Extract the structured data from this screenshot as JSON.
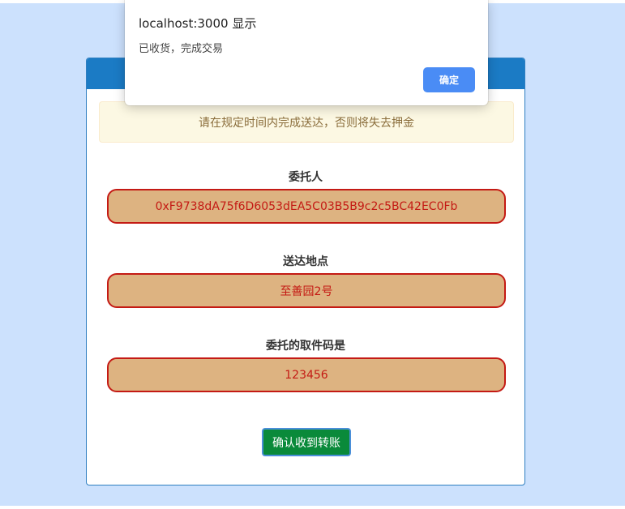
{
  "alert": {
    "title": "localhost:3000 显示",
    "message": "已收货，完成交易",
    "ok_label": "确定"
  },
  "card": {
    "warning": "请在规定时间内完成送达，否则将失去押金",
    "fields": [
      {
        "label": "委托人",
        "value": "0xF9738dA75f6D6053dEA5C03B5B9c2c5BC42EC0Fb"
      },
      {
        "label": "送达地点",
        "value": "至善园2号"
      },
      {
        "label": "委托的取件码是",
        "value": "123456"
      }
    ],
    "confirm_label": "确认收到转账"
  },
  "colors": {
    "page_background": "#cce1fd",
    "card_header": "#1b7bc5",
    "field_fill": "#ddb381",
    "field_border": "#c41a14",
    "confirm_button": "#0a8a3a",
    "alert_button": "#4a8cf5"
  }
}
